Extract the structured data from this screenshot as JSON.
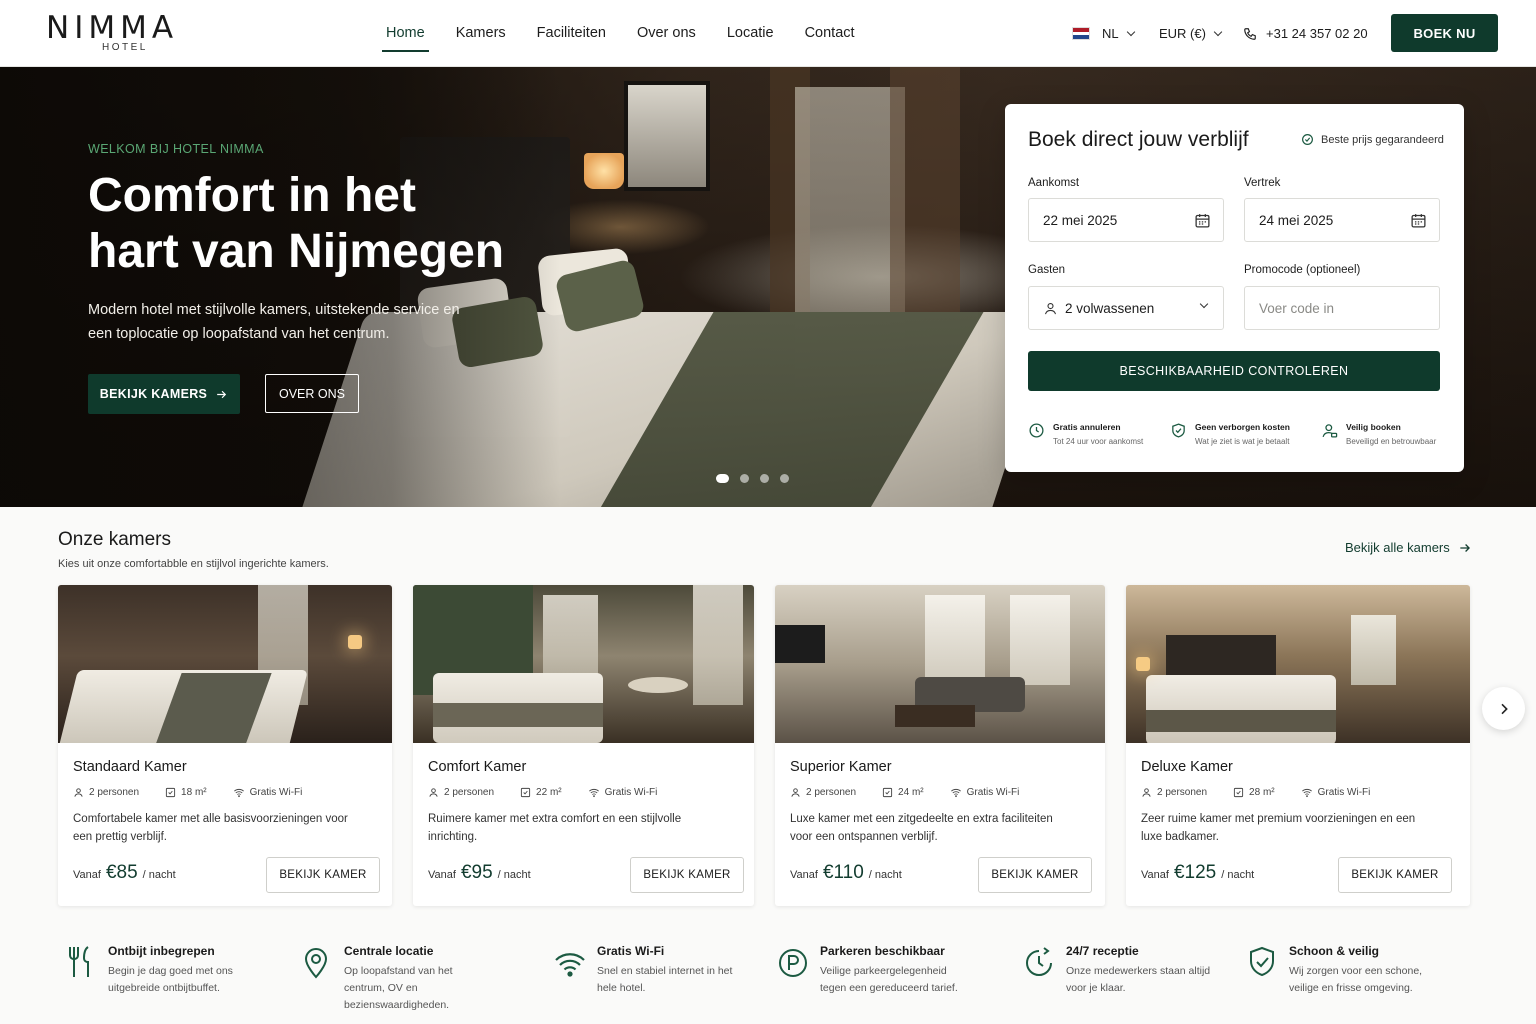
{
  "header": {
    "logo": "NIMMA",
    "logo_sub": "HOTEL",
    "nav": [
      "Home",
      "Kamers",
      "Faciliteiten",
      "Over ons",
      "Locatie",
      "Contact"
    ],
    "active_nav": "Home",
    "language": "NL",
    "currency": "EUR (€)",
    "phone": "+31 24 357 02 20",
    "book_label": "BOEK NU",
    "brand_color": "#0f3a2c"
  },
  "hero": {
    "eyebrow": "WELKOM BIJ HOTEL NIMMA",
    "title_line1": "Comfort in het",
    "title_line2": "hart van Nijmegen",
    "description": "Modern hotel met stijlvolle kamers, uitstekende service en een toplocatie op loopafstand van het centrum.",
    "primary_button": "BEKIJK KAMERS",
    "secondary_button": "OVER ONS",
    "slides_total": 4,
    "active_slide": 1
  },
  "booking": {
    "title": "Boek direct jouw verblijf",
    "badge": "Beste prijs gegarandeerd",
    "arrival_label": "Aankomst",
    "arrival_value": "22 mei 2025",
    "departure_label": "Vertrek",
    "departure_value": "24 mei 2025",
    "guests_label": "Gasten",
    "guests_value": "2 volwassenen",
    "promo_label": "Promocode (optioneel)",
    "promo_placeholder": "Voer code in",
    "check_button": "BESCHIKBAARHEID CONTROLEREN",
    "features": [
      {
        "icon": "clock-icon",
        "title": "Gratis annuleren",
        "text": "Tot 24 uur voor aankomst"
      },
      {
        "icon": "shield-check-icon",
        "title": "Geen verborgen kosten",
        "text": "Wat je ziet is wat je betaalt"
      },
      {
        "icon": "user-lock-icon",
        "title": "Veilig booken",
        "text": "Beveiligd en betrouwbaar"
      }
    ]
  },
  "rooms": {
    "title": "Onze kamers",
    "subtitle": "Kies uit onze comfortabble en stijlvol ingerichte kamers.",
    "see_all": "Bekijk alle kamers",
    "price_prefix": "Vanaf",
    "price_suffix": "/ nacht",
    "button_label": "BEKIJK KAMER",
    "items": [
      {
        "name": "Standaard Kamer",
        "persons": "2 personen",
        "size": "18 m²",
        "wifi": "Gratis Wi-Fi",
        "description": "Comfortabele kamer met alle basisvoorzieningen voor een prettig verblijf.",
        "price": "€85"
      },
      {
        "name": "Comfort Kamer",
        "persons": "2 personen",
        "size": "22 m²",
        "wifi": "Gratis Wi-Fi",
        "description": "Ruimere kamer met extra comfort en een stijlvolle inrichting.",
        "price": "€95"
      },
      {
        "name": "Superior Kamer",
        "persons": "2 personen",
        "size": "24 m²",
        "wifi": "Gratis Wi-Fi",
        "description": "Luxe kamer met een zitgedeelte en extra faciliteiten voor een ontspannen verblijf.",
        "price": "€110"
      },
      {
        "name": "Deluxe Kamer",
        "persons": "2 personen",
        "size": "28 m²",
        "wifi": "Gratis Wi-Fi",
        "description": "Zeer ruime kamer met premium voorzieningen en een luxe badkamer.",
        "price": "€125"
      }
    ]
  },
  "features": [
    {
      "icon": "cutlery-icon",
      "title": "Ontbijt inbegrepen",
      "text": "Begin je dag goed met ons uitgebreide ontbijtbuffet."
    },
    {
      "icon": "location-pin-icon",
      "title": "Centrale locatie",
      "text": "Op loopafstand van het centrum, OV en bezienswaardigheden."
    },
    {
      "icon": "wifi-icon",
      "title": "Gratis Wi-Fi",
      "text": "Snel en stabiel internet in het hele hotel."
    },
    {
      "icon": "parking-icon",
      "title": "Parkeren beschikbaar",
      "text": "Veilige parkeergelegenheid tegen een gereduceerd tarief."
    },
    {
      "icon": "clock-24-icon",
      "title": "24/7 receptie",
      "text": "Onze medewerkers staan altijd voor je klaar."
    },
    {
      "icon": "shield-check-icon",
      "title": "Schoon & veilig",
      "text": "Wij zorgen voor een schone, veilige en frisse omgeving."
    }
  ]
}
